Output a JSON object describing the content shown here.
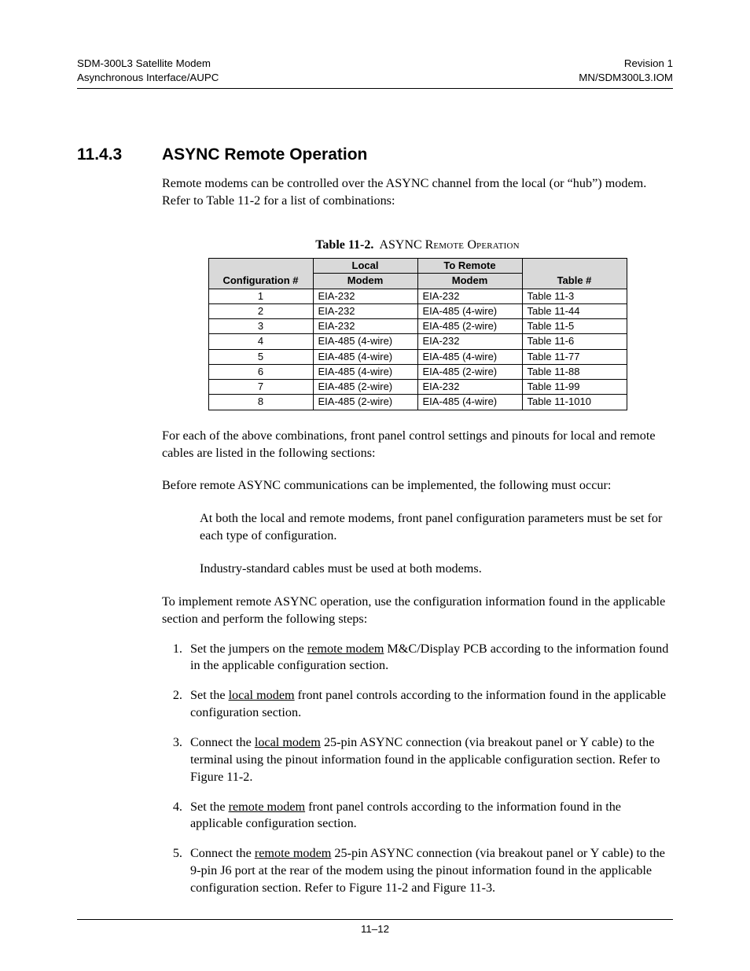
{
  "header": {
    "left1": "SDM-300L3 Satellite Modem",
    "left2": "Asynchronous Interface/AUPC",
    "right1": "Revision 1",
    "right2": "MN/SDM300L3.IOM"
  },
  "section": {
    "number": "11.4.3",
    "title": "ASYNC Remote Operation"
  },
  "intro": "Remote modems can be controlled over the ASYNC channel from the local (or “hub”) modem. Refer to Table 11-2 for a list of combinations:",
  "table_caption_bold": "Table 11-2.",
  "table_caption_rest_a": "ASYNC R",
  "table_caption_rest_b": "emote ",
  "table_caption_rest_c": "O",
  "table_caption_rest_d": "peration",
  "table": {
    "headers": {
      "c1": "Configuration #",
      "c2a": "Local",
      "c2b": "Modem",
      "c3a": "To Remote",
      "c3b": "Modem",
      "c4": "Table #"
    },
    "rows": [
      {
        "n": "1",
        "local": "EIA-232",
        "remote": "EIA-232",
        "table": "Table 11-3"
      },
      {
        "n": "2",
        "local": "EIA-232",
        "remote": "EIA-485 (4-wire)",
        "table": "Table 11-44"
      },
      {
        "n": "3",
        "local": "EIA-232",
        "remote": "EIA-485 (2-wire)",
        "table": "Table 11-5"
      },
      {
        "n": "4",
        "local": "EIA-485 (4-wire)",
        "remote": "EIA-232",
        "table": "Table 11-6"
      },
      {
        "n": "5",
        "local": "EIA-485 (4-wire)",
        "remote": "EIA-485 (4-wire)",
        "table": "Table 11-77"
      },
      {
        "n": "6",
        "local": "EIA-485 (4-wire)",
        "remote": "EIA-485 (2-wire)",
        "table": "Table 11-88"
      },
      {
        "n": "7",
        "local": "EIA-485 (2-wire)",
        "remote": "EIA-232",
        "table": "Table 11-99"
      },
      {
        "n": "8",
        "local": "EIA-485 (2-wire)",
        "remote": "EIA-485 (4-wire)",
        "table": "Table 11-1010"
      }
    ]
  },
  "p_after_table": "For each of the above combinations, front panel control settings and pinouts for local and remote cables are listed in the following sections:",
  "p_before": "Before remote ASYNC communications can be implemented, the following must occur:",
  "bullet1": "At both the local and remote modems, front panel configuration parameters must be set for each type of configuration.",
  "bullet2": "Industry-standard cables must be used at both modems.",
  "p_implement": "To implement remote ASYNC operation, use the configuration information found in the applicable section and perform the following steps:",
  "steps": {
    "s1a": "Set the jumpers on the ",
    "s1u": "remote modem",
    "s1b": " M&C/Display PCB according to the information found in the applicable configuration section.",
    "s2a": "Set the ",
    "s2u": "local modem",
    "s2b": " front panel controls according to the information found in the applicable configuration section.",
    "s3a": "Connect the ",
    "s3u": "local modem",
    "s3b": " 25-pin ASYNC connection (via breakout panel or Y cable) to the terminal using the pinout information found in the applicable configuration section. Refer to Figure 11-2.",
    "s4a": "Set the ",
    "s4u": "remote modem",
    "s4b": " front panel controls according to the information found in the applicable configuration section.",
    "s5a": "Connect the ",
    "s5u": "remote modem",
    "s5b": " 25-pin ASYNC connection (via breakout panel or Y cable) to the 9-pin J6 port at the rear of the modem using the pinout information found in the applicable configuration section. Refer to Figure 11-2 and Figure 11-3."
  },
  "footer": {
    "page": "11–12"
  }
}
